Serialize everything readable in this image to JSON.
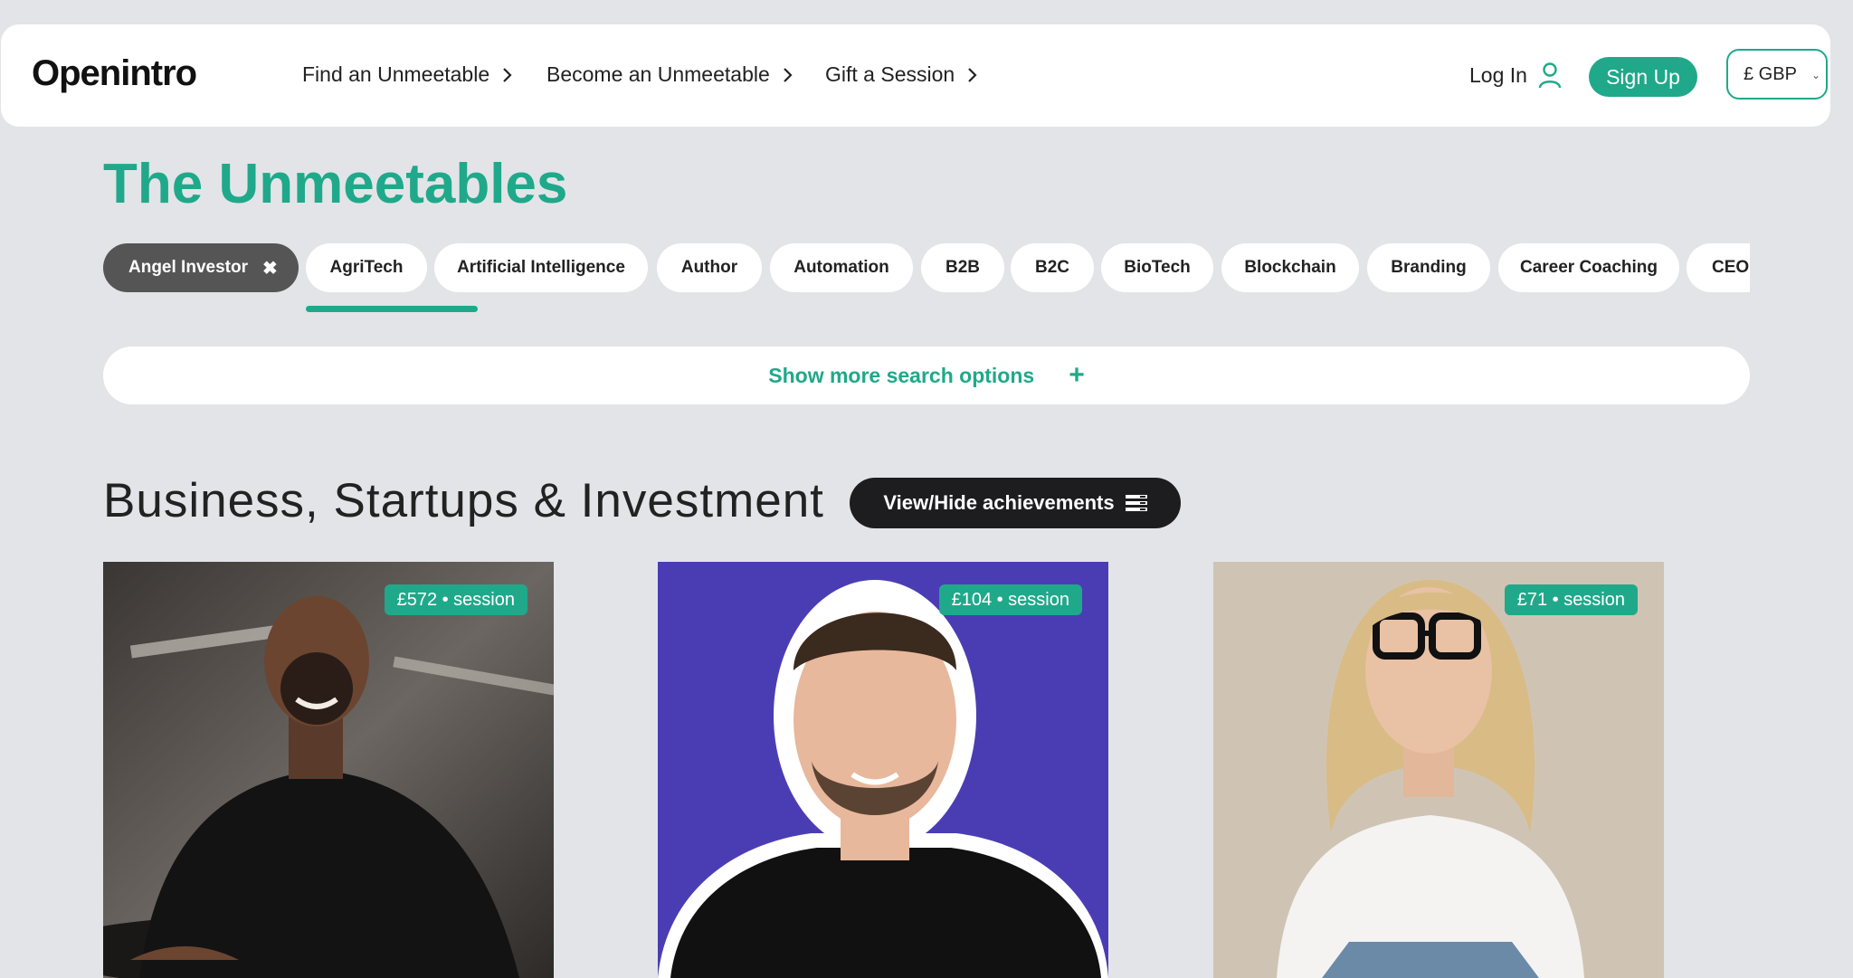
{
  "header": {
    "logo": "Openintro",
    "nav": [
      {
        "label": "Find an Unmeetable"
      },
      {
        "label": "Become an Unmeetable"
      },
      {
        "label": "Gift a Session"
      }
    ],
    "login_label": "Log In",
    "signup_label": "Sign Up",
    "currency": "£ GBP"
  },
  "page_title": "The Unmeetables",
  "tags": [
    {
      "label": "Angel Investor",
      "active": true
    },
    {
      "label": "AgriTech"
    },
    {
      "label": "Artificial Intelligence"
    },
    {
      "label": "Author"
    },
    {
      "label": "Automation"
    },
    {
      "label": "B2B"
    },
    {
      "label": "B2C"
    },
    {
      "label": "BioTech"
    },
    {
      "label": "Blockchain"
    },
    {
      "label": "Branding"
    },
    {
      "label": "Career Coaching"
    },
    {
      "label": "CEO"
    }
  ],
  "search": {
    "more_options_label": "Show more search options"
  },
  "section": {
    "title": "Business, Startups & Investment",
    "achievements_label": "View/Hide achievements"
  },
  "cards": [
    {
      "price": "£572 • session"
    },
    {
      "price": "£104 • session"
    },
    {
      "price": "£71 • session"
    }
  ],
  "colors": {
    "accent": "#1fa98a",
    "card2_bg": "#4a3db4"
  }
}
